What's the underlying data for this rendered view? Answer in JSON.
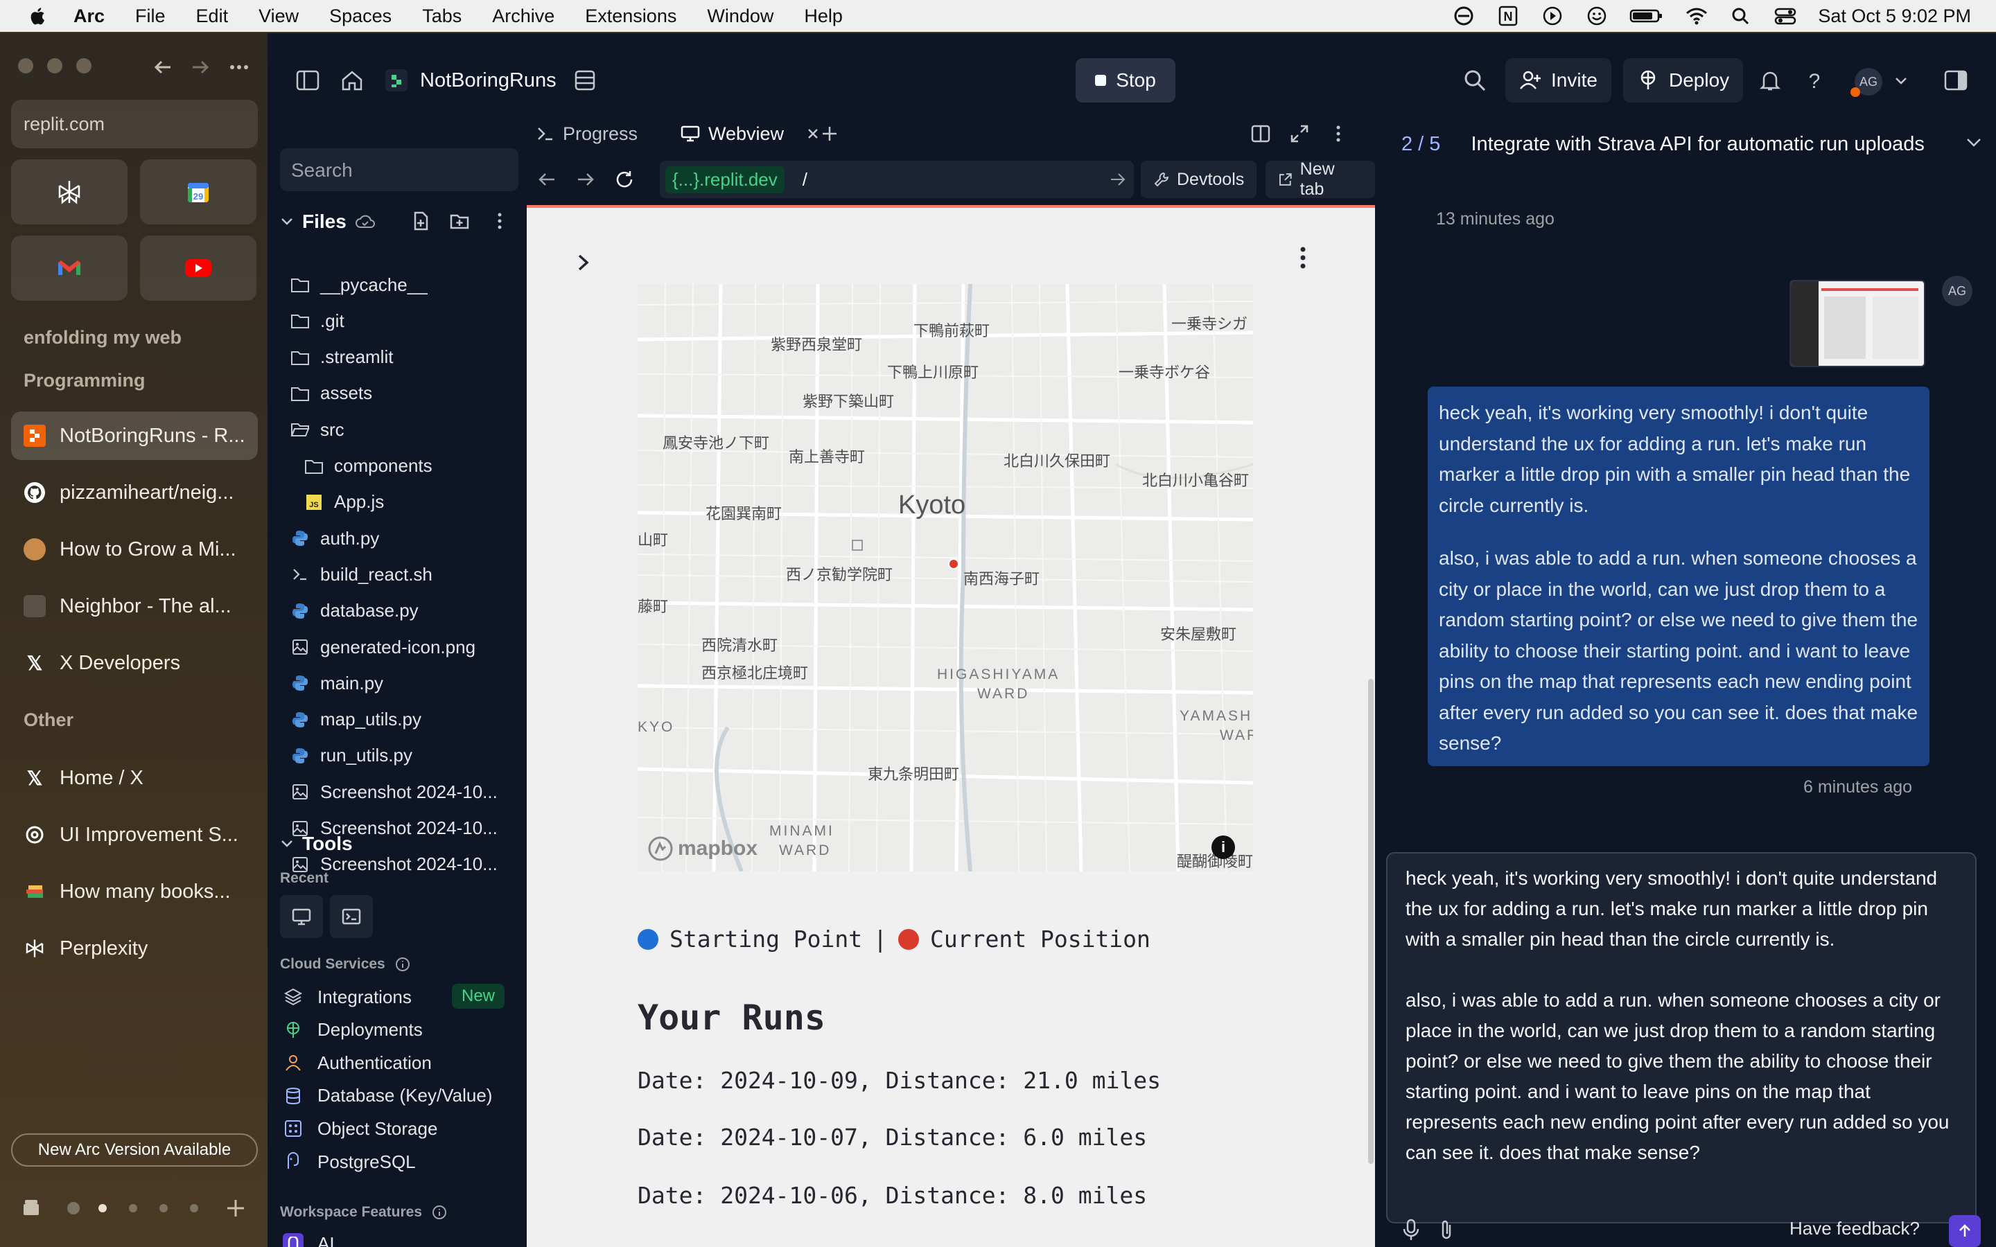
{
  "menubar": {
    "app": "Arc",
    "items": [
      "File",
      "Edit",
      "View",
      "Spaces",
      "Tabs",
      "Archive",
      "Extensions",
      "Window",
      "Help"
    ],
    "datetime": "Sat Oct 5  9:02 PM"
  },
  "arc": {
    "url": "replit.com",
    "space_label": "enfolding my web",
    "section_programming": "Programming",
    "section_other": "Other",
    "tabs_programming": [
      "NotBoringRuns - R...",
      "pizzamiheart/neig...",
      "How to Grow a Mi...",
      "Neighbor - The al...",
      "X Developers"
    ],
    "tabs_other": [
      "Home / X",
      "UI Improvement S...",
      "How many books...",
      "Perplexity"
    ],
    "update_label": "New Arc Version Available"
  },
  "replit": {
    "project": "NotBoringRuns",
    "stop_label": "Stop",
    "invite_label": "Invite",
    "deploy_label": "Deploy",
    "avatar": "AG",
    "search_placeholder": "Search",
    "files_label": "Files",
    "files": [
      "__pycache__",
      ".git",
      ".streamlit",
      "assets",
      "src",
      "components",
      "App.js",
      "auth.py",
      "build_react.sh",
      "database.py",
      "generated-icon.png",
      "main.py",
      "map_utils.py",
      "run_utils.py",
      "Screenshot 2024-10...",
      "Screenshot 2024-10...",
      "Screenshot 2024-10..."
    ],
    "tools_label": "Tools",
    "recent_label": "Recent",
    "cloud_label": "Cloud Services",
    "cloud_items": [
      "Integrations",
      "Deployments",
      "Authentication",
      "Database (Key/Value)",
      "Object Storage",
      "PostgreSQL"
    ],
    "new_badge": "New",
    "workspace_label": "Workspace Features",
    "workspace_items": [
      "AI"
    ]
  },
  "webview": {
    "tab_progress": "Progress",
    "tab_webview": "Webview",
    "url_host": "{...}.replit.dev",
    "url_path": "/",
    "devtools": "Devtools",
    "newtab": "New tab",
    "map_city": "Kyoto",
    "map_labels": [
      "下鴨前萩町",
      "紫野西泉堂町",
      "一乗寺シガ",
      "下鴨上川原町",
      "一乗寺ボケ谷",
      "紫野下築山町",
      "鳳安寺池ノ下町",
      "南上善寺町",
      "北白川久保田町",
      "北白川小亀谷町",
      "花園巽南町",
      "山町",
      "西ノ京勧学院町",
      "南西海子町",
      "藤町",
      "西院清水町",
      "西京極北庄境町",
      "安朱屋敷町",
      "東九条明田町",
      "醍醐御陵町"
    ],
    "map_wards": [
      "HIGASHIYAMA",
      "WARD",
      "KYO",
      "YAMASH",
      "WARD",
      "MINAMI",
      "WARD"
    ],
    "mapbox": "mapbox",
    "legend_start": "Starting Point",
    "legend_sep": "|",
    "legend_current": "Current Position",
    "runs_title": "Your Runs",
    "runs": [
      "Date: 2024-10-09, Distance: 21.0 miles",
      "Date: 2024-10-07, Distance: 6.0 miles",
      "Date: 2024-10-06, Distance: 8.0 miles"
    ]
  },
  "chat": {
    "counter": "2 / 5",
    "task": "Integrate with Strava API for automatic run uploads",
    "ts1": "13 minutes ago",
    "avatar": "AG",
    "msg_p1": "heck yeah, it's working very smoothly! i don't quite understand the ux for adding a run. let's make run marker a little drop pin with a smaller pin head than the circle currently is.",
    "msg_p2": "also, i was able to add a run. when someone chooses a city or place in the world, can we just drop them to a random starting point? or else we need to give them the ability to choose their starting point. and i want to leave pins on the map that represents each new ending point after every run added so you can see it. does that make sense?",
    "ts2": "6 minutes ago",
    "feedback": "Have feedback?"
  },
  "colors": {
    "accent": "#5b3fd4",
    "bubble": "#1a4183",
    "start_dot": "#1f6fd6",
    "current_dot": "#d93a2b"
  }
}
